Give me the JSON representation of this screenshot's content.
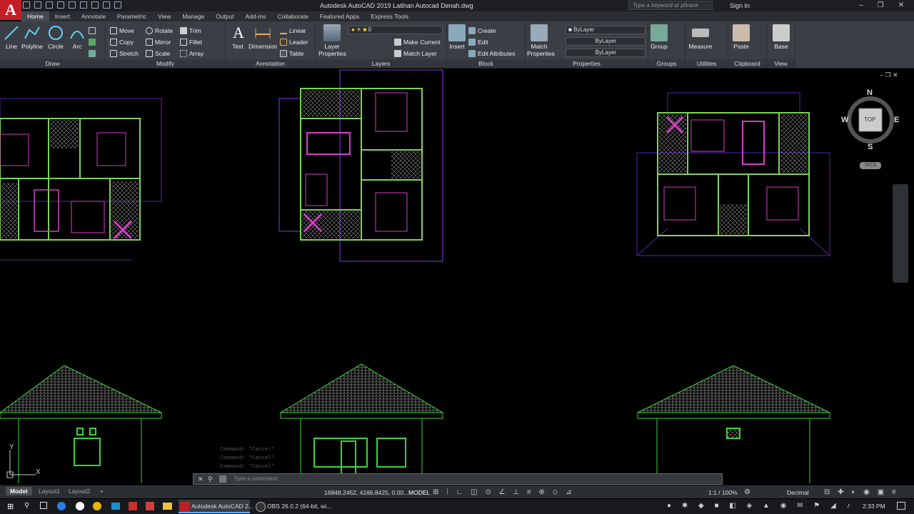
{
  "app": {
    "logo": "A",
    "title": "Autodesk AutoCAD 2019   Latihan Autocad Denah.dwg",
    "search_placeholder": "Type a keyword or phrase",
    "sign_in": "Sign In"
  },
  "tabs": [
    "Home",
    "Insert",
    "Annotate",
    "Parametric",
    "View",
    "Manage",
    "Output",
    "Add-ins",
    "Collaborate",
    "Featured Apps",
    "Express Tools"
  ],
  "ribbon": {
    "draw": {
      "title": "Draw",
      "line": "Line",
      "polyline": "Polyline",
      "circle": "Circle",
      "arc": "Arc"
    },
    "modify": {
      "title": "Modify",
      "move": "Move",
      "rotate": "Rotate",
      "trim": "Trim",
      "copy": "Copy",
      "mirror": "Mirror",
      "fillet": "Fillet",
      "stretch": "Stretch",
      "scale": "Scale",
      "array": "Array"
    },
    "annotation": {
      "title": "Annotation",
      "text": "Text",
      "dimension": "Dimension",
      "linear": "Linear",
      "leader": "Leader",
      "table": "Table"
    },
    "layers": {
      "title": "Layers",
      "layer_properties": "Layer Properties",
      "current_layer": "0",
      "make_current": "Make Current",
      "match_layer": "Match Layer"
    },
    "block": {
      "title": "Block",
      "insert": "Insert",
      "create": "Create",
      "edit": "Edit",
      "edit_attributes": "Edit Attributes"
    },
    "properties": {
      "title": "Properties",
      "match_properties": "Match Properties",
      "color": "ByLayer",
      "linetype": "ByLayer",
      "lineweight": "ByLayer"
    },
    "groups": {
      "title": "Groups",
      "group": "Group"
    },
    "utilities": {
      "title": "Utilities",
      "measure": "Measure"
    },
    "clipboard": {
      "title": "Clipboard",
      "paste": "Paste"
    },
    "view": {
      "title": "View",
      "base": "Base"
    }
  },
  "viewcube": {
    "n": "N",
    "s": "S",
    "e": "E",
    "w": "W",
    "face": "TOP",
    "wcs": "WCS"
  },
  "ucs": {
    "x": "X",
    "y": "Y"
  },
  "command": {
    "history": [
      "Command: *Cancel*",
      "Command: *Cancel*",
      "Command: *Cancel*"
    ],
    "placeholder": "Type a command"
  },
  "status": {
    "tabs": [
      "Model",
      "Layout1",
      "Layout2"
    ],
    "coords": "16848.2452, 4166.8425, 0.00...",
    "model": "MODEL",
    "scale": "1:1 / 100%",
    "units": "Decimal"
  },
  "taskbar": {
    "autocad": "Autodesk AutoCAD 2...",
    "obs": "OBS 26.0.2 (64-bit, wi...",
    "time": "2:33 PM"
  },
  "colors": {
    "plan_wall": "#7fd35a",
    "plan_magenta": "#d63cc8",
    "plan_purple": "#5a22a8",
    "elev_green": "#3bd43b"
  }
}
